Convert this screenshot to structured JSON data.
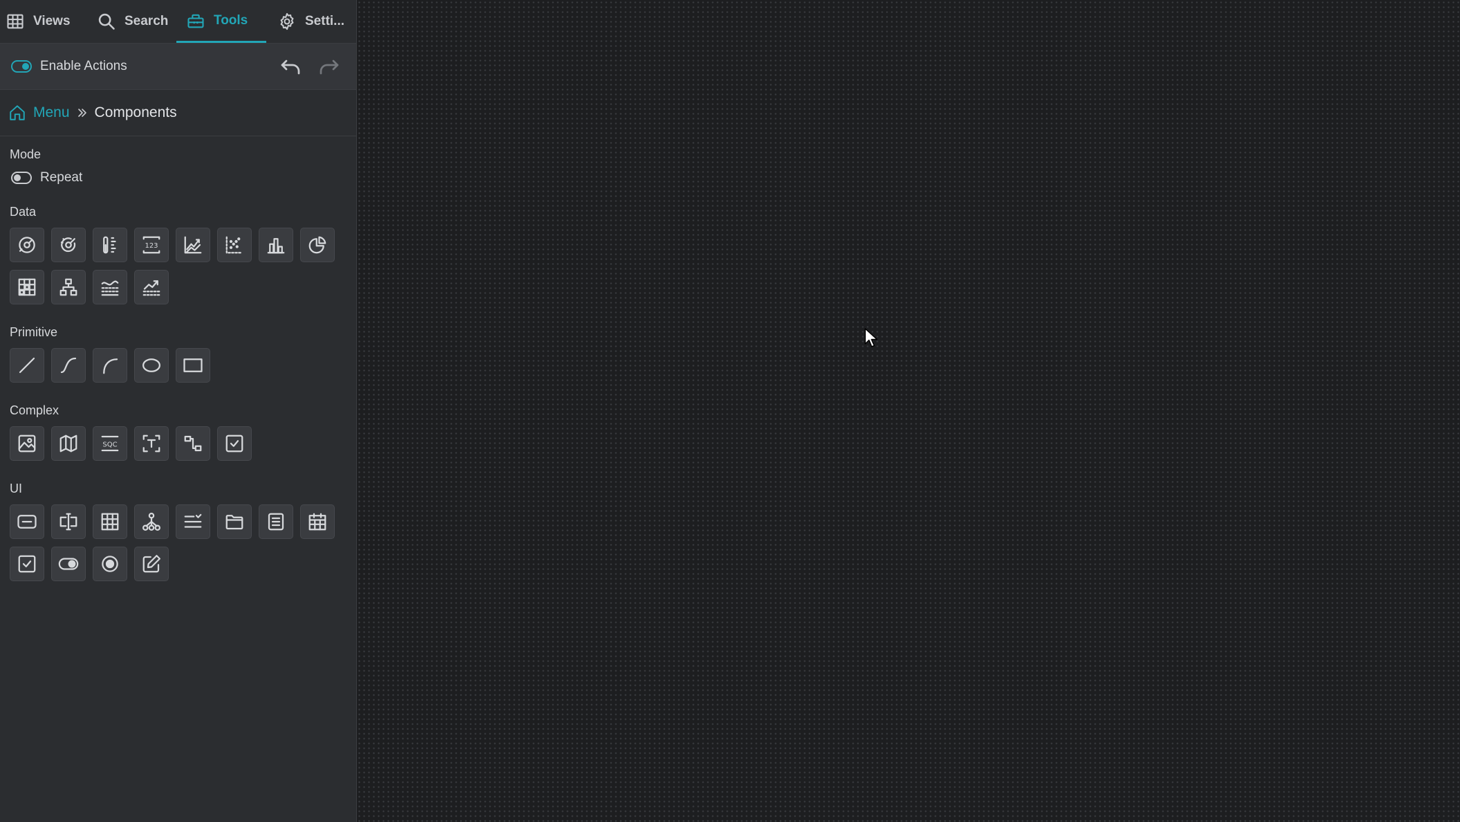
{
  "tabs": {
    "views": "Views",
    "search": "Search",
    "tools": "Tools",
    "settings": "Setti..."
  },
  "actions": {
    "enable_label": "Enable Actions",
    "enabled": true
  },
  "breadcrumb": {
    "root": "Menu",
    "current": "Components"
  },
  "mode": {
    "title": "Mode",
    "repeat_label": "Repeat",
    "repeat_enabled": false
  },
  "sections": {
    "data": {
      "title": "Data",
      "tools": [
        "gauge-icon",
        "radial-gauge-icon",
        "slider-gauge-icon",
        "numeric-display-icon",
        "line-chart-icon",
        "scatter-chart-icon",
        "bar-chart-icon",
        "pie-chart-icon",
        "heatmap-icon",
        "tree-icon",
        "threshold-chart-icon",
        "trend-chart-icon"
      ]
    },
    "primitive": {
      "title": "Primitive",
      "tools": [
        "line-icon",
        "curve-icon",
        "arc-icon",
        "ellipse-icon",
        "rectangle-icon"
      ]
    },
    "complex": {
      "title": "Complex",
      "tools": [
        "image-icon",
        "map-icon",
        "sqc-icon",
        "text-box-icon",
        "connector-icon",
        "checklist-icon"
      ]
    },
    "ui": {
      "title": "UI",
      "tools": [
        "button-icon",
        "text-input-icon",
        "table-icon",
        "hierarchy-icon",
        "dropdown-icon",
        "folder-icon",
        "list-icon",
        "calendar-icon",
        "checkbox-icon",
        "toggle-icon",
        "radio-icon",
        "edit-icon"
      ]
    }
  },
  "icons": {
    "sqc_text": "SQC",
    "numeric_text": "123"
  },
  "colors": {
    "accent": "#22a6b7",
    "panel": "#2b2d30",
    "canvas": "#1d1e20"
  }
}
